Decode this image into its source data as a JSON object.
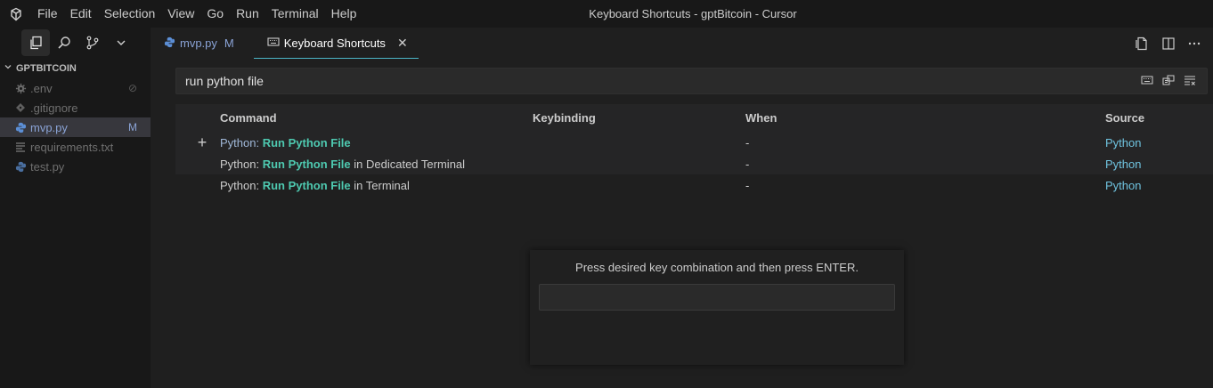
{
  "titlebar": {
    "menu": [
      "File",
      "Edit",
      "Selection",
      "View",
      "Go",
      "Run",
      "Terminal",
      "Help"
    ],
    "window_title": "Keyboard Shortcuts - gptBitcoin - Cursor"
  },
  "explorer": {
    "folder_name": "GPTBITCOIN",
    "files": [
      {
        "name": ".env",
        "icon": "gear-icon",
        "badge": "⊘"
      },
      {
        "name": ".gitignore",
        "icon": "git-icon",
        "badge": ""
      },
      {
        "name": "mvp.py",
        "icon": "python-icon",
        "badge": "M"
      },
      {
        "name": "requirements.txt",
        "icon": "lines-icon",
        "badge": ""
      },
      {
        "name": "test.py",
        "icon": "python-icon",
        "badge": ""
      }
    ]
  },
  "tabs": [
    {
      "label": "mvp.py",
      "status": "M"
    },
    {
      "label": "Keyboard Shortcuts",
      "close": "✕"
    }
  ],
  "search": {
    "value": "run python file"
  },
  "table": {
    "headers": {
      "command": "Command",
      "keybinding": "Keybinding",
      "when": "When",
      "source": "Source"
    },
    "rows": [
      {
        "prefix": "Python: ",
        "bold": "Run Python File",
        "suffix": "",
        "keybinding": "",
        "when": "-",
        "source": "Python"
      },
      {
        "prefix": "Python: ",
        "bold": "Run Python File",
        "suffix": " in Dedicated Terminal",
        "keybinding": "",
        "when": "-",
        "source": "Python"
      },
      {
        "prefix": "Python: ",
        "bold": "Run Python File",
        "suffix": " in Terminal",
        "keybinding": "",
        "when": "-",
        "source": "Python"
      }
    ],
    "add_icon": "+"
  },
  "keybinding_dialog": {
    "message": "Press desired key combination and then press ENTER."
  },
  "colors": {
    "accent": "#4bb6c7",
    "command_highlight": "#4ec9b0",
    "source_link": "#6fc3df",
    "modified": "#8aa3d6"
  }
}
